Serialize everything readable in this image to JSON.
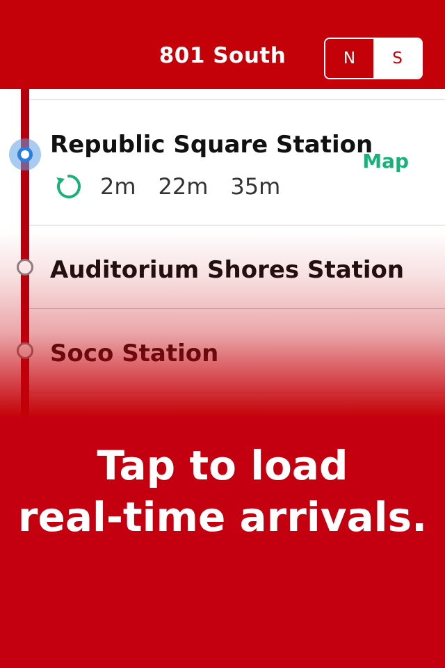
{
  "header": {
    "title": "801 South",
    "direction_north": "N",
    "direction_south": "S",
    "selected_direction": "S"
  },
  "stations": {
    "current": {
      "name": "Republic Square Station",
      "arrivals": [
        "2m",
        "22m",
        "35m"
      ],
      "map_label": "Map"
    },
    "next": [
      {
        "name": "Auditorium Shores Station"
      },
      {
        "name": "Soco Station"
      }
    ]
  },
  "overlay": {
    "line1": "Tap to load",
    "line2": "real-time arrivals."
  },
  "colors": {
    "brand_red": "#c40008",
    "map_green": "#1ab07a",
    "current_blue": "#2a7de1"
  },
  "icons": {
    "refresh": "refresh-icon"
  }
}
